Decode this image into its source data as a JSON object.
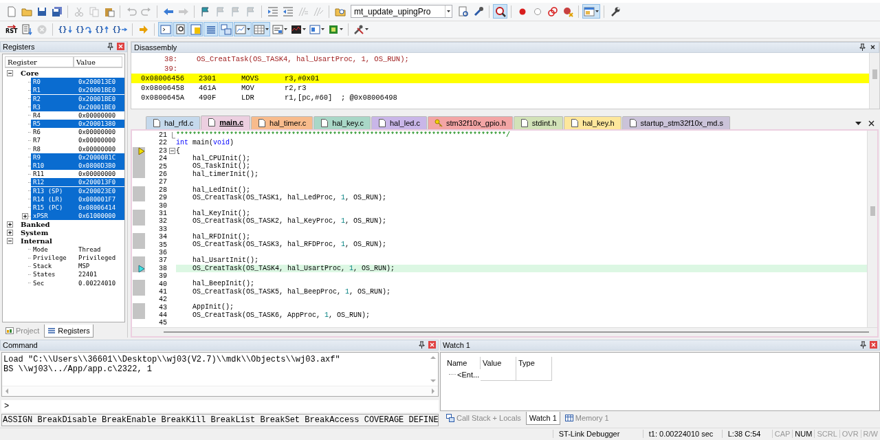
{
  "toolbar_1": [
    {
      "kind": "button",
      "on": false,
      "disabled": false,
      "dropdown": false
    },
    {
      "kind": "button",
      "on": false,
      "disabled": false,
      "dropdown": false
    },
    {
      "kind": "button",
      "on": false,
      "disabled": false,
      "dropdown": false
    },
    {
      "kind": "button",
      "on": false,
      "disabled": false,
      "dropdown": false
    },
    {
      "kind": "separator"
    },
    {
      "kind": "button",
      "on": false,
      "disabled": true,
      "dropdown": false
    },
    {
      "kind": "button",
      "on": false,
      "disabled": true,
      "dropdown": false
    },
    {
      "kind": "button",
      "on": false,
      "disabled": false,
      "dropdown": false
    },
    {
      "kind": "separator"
    },
    {
      "kind": "button",
      "on": false,
      "disabled": true,
      "dropdown": false
    },
    {
      "kind": "button",
      "on": false,
      "disabled": true,
      "dropdown": false
    },
    {
      "kind": "separator"
    },
    {
      "kind": "button",
      "on": false,
      "disabled": false,
      "dropdown": false
    },
    {
      "kind": "button",
      "on": false,
      "disabled": true,
      "dropdown": false
    },
    {
      "kind": "separator"
    },
    {
      "kind": "button",
      "on": false,
      "disabled": false,
      "dropdown": false
    },
    {
      "kind": "button",
      "on": false,
      "disabled": true,
      "dropdown": false
    },
    {
      "kind": "button",
      "on": false,
      "disabled": true,
      "dropdown": false
    },
    {
      "kind": "button",
      "on": false,
      "disabled": true,
      "dropdown": false
    },
    {
      "kind": "separator"
    },
    {
      "kind": "button",
      "on": false,
      "disabled": false,
      "dropdown": false
    },
    {
      "kind": "button",
      "on": false,
      "disabled": false,
      "dropdown": false
    },
    {
      "kind": "button",
      "on": false,
      "disabled": true,
      "dropdown": false
    },
    {
      "kind": "button",
      "on": false,
      "disabled": true,
      "dropdown": false
    },
    {
      "kind": "separator"
    },
    {
      "kind": "button",
      "on": false,
      "disabled": false,
      "dropdown": false
    },
    {
      "kind": "combo",
      "value": "mt_update_upingPro"
    },
    {
      "kind": "button",
      "on": false,
      "disabled": false,
      "dropdown": false
    },
    {
      "kind": "button",
      "on": false,
      "disabled": false,
      "dropdown": false
    },
    {
      "kind": "separator"
    },
    {
      "kind": "button",
      "on": true,
      "disabled": false,
      "dropdown": false
    },
    {
      "kind": "separator"
    },
    {
      "kind": "button",
      "on": false,
      "disabled": false,
      "dropdown": false
    },
    {
      "kind": "button",
      "on": false,
      "disabled": false,
      "dropdown": false
    },
    {
      "kind": "button",
      "on": false,
      "disabled": false,
      "dropdown": false
    },
    {
      "kind": "button",
      "on": false,
      "disabled": false,
      "dropdown": false
    },
    {
      "kind": "separator"
    },
    {
      "kind": "button",
      "on": true,
      "disabled": false,
      "dropdown": true
    },
    {
      "kind": "separator"
    },
    {
      "kind": "button",
      "on": false,
      "disabled": false,
      "dropdown": false
    }
  ],
  "toolbar_2": [
    {
      "kind": "button",
      "label": "RST",
      "on": false,
      "disabled": false,
      "dropdown": false
    },
    {
      "kind": "button",
      "on": false,
      "disabled": false,
      "dropdown": false
    },
    {
      "kind": "button",
      "on": false,
      "disabled": true,
      "dropdown": false
    },
    {
      "kind": "separator"
    },
    {
      "kind": "button",
      "label": "{}",
      "on": false,
      "disabled": false,
      "dropdown": false
    },
    {
      "kind": "button",
      "label": "{}",
      "on": false,
      "disabled": false,
      "dropdown": false
    },
    {
      "kind": "button",
      "label": "{}",
      "on": false,
      "disabled": false,
      "dropdown": false
    },
    {
      "kind": "button",
      "label": "{}",
      "on": false,
      "disabled": false,
      "dropdown": false
    },
    {
      "kind": "separator"
    },
    {
      "kind": "button",
      "on": false,
      "disabled": false,
      "dropdown": false
    },
    {
      "kind": "separator"
    },
    {
      "kind": "button",
      "on": true,
      "disabled": false,
      "dropdown": false
    },
    {
      "kind": "button",
      "on": true,
      "disabled": false,
      "dropdown": false
    },
    {
      "kind": "button",
      "on": true,
      "disabled": false,
      "dropdown": false
    },
    {
      "kind": "button",
      "on": true,
      "disabled": false,
      "dropdown": false
    },
    {
      "kind": "button",
      "on": true,
      "disabled": false,
      "dropdown": false
    },
    {
      "kind": "button",
      "on": true,
      "disabled": false,
      "dropdown": true
    },
    {
      "kind": "button",
      "on": true,
      "disabled": false,
      "dropdown": true
    },
    {
      "kind": "button",
      "on": false,
      "disabled": false,
      "dropdown": true
    },
    {
      "kind": "button",
      "on": false,
      "disabled": false,
      "dropdown": true
    },
    {
      "kind": "button",
      "on": false,
      "disabled": false,
      "dropdown": true
    },
    {
      "kind": "button",
      "on": false,
      "disabled": false,
      "dropdown": true
    },
    {
      "kind": "separator"
    },
    {
      "kind": "button",
      "on": false,
      "disabled": false,
      "dropdown": true
    }
  ],
  "registers": {
    "header": {
      "title": "Registers",
      "active": true
    },
    "columns": [
      "Register",
      "Value"
    ],
    "tree": [
      {
        "label": "Core",
        "expanded": true,
        "children": [
          {
            "label": "R0",
            "value": "0x200013E0",
            "changed": true
          },
          {
            "label": "R1",
            "value": "0x20001BE0",
            "changed": true
          },
          {
            "label": "R2",
            "value": "0x20001BE0",
            "changed": true
          },
          {
            "label": "R3",
            "value": "0x20001BE0",
            "changed": true
          },
          {
            "label": "R4",
            "value": "0x00000000",
            "changed": false
          },
          {
            "label": "R5",
            "value": "0x20001380",
            "changed": true
          },
          {
            "label": "R6",
            "value": "0x00000000",
            "changed": false
          },
          {
            "label": "R7",
            "value": "0x00000000",
            "changed": false
          },
          {
            "label": "R8",
            "value": "0x00000000",
            "changed": false
          },
          {
            "label": "R9",
            "value": "0x2000081C",
            "changed": true
          },
          {
            "label": "R10",
            "value": "0x0800D3B0",
            "changed": true
          },
          {
            "label": "R11",
            "value": "0x00000000",
            "changed": false
          },
          {
            "label": "R12",
            "value": "0x200013F0",
            "changed": true
          },
          {
            "label": "R13 (SP)",
            "value": "0x200023E0",
            "changed": true
          },
          {
            "label": "R14 (LR)",
            "value": "0x080001F7",
            "changed": true
          },
          {
            "label": "R15 (PC)",
            "value": "0x08006414",
            "changed": true
          },
          {
            "label": "xPSR",
            "value": "0x61000000",
            "changed": true,
            "expanded": false
          }
        ]
      },
      {
        "label": "Banked",
        "expanded": false
      },
      {
        "label": "System",
        "expanded": false
      },
      {
        "label": "Internal",
        "expanded": true,
        "children": [
          {
            "label": "Mode",
            "value": "Thread",
            "changed": false
          },
          {
            "label": "Privilege",
            "value": "Privileged",
            "changed": false
          },
          {
            "label": "Stack",
            "value": "MSP",
            "changed": false
          },
          {
            "label": "States",
            "value": "22401",
            "changed": false
          },
          {
            "label": "Sec",
            "value": "0.00224010",
            "changed": false
          }
        ]
      }
    ],
    "tabs": [
      {
        "label": "Project",
        "selected": false
      },
      {
        "label": "Registers",
        "selected": true
      }
    ]
  },
  "disassembly": {
    "header": {
      "title": "Disassembly",
      "active": false
    },
    "lines": [
      {
        "kind": "source",
        "line": "38:",
        "text": "OS_CreatTask(OS_TASK4, hal_UsartProc, 1, OS_RUN);"
      },
      {
        "kind": "source",
        "line": "39:"
      },
      {
        "kind": "asm",
        "address": "0x08006456",
        "opcode": "2301",
        "mnemonic": "MOVS",
        "operands": "r3,#0x01",
        "current": true
      },
      {
        "kind": "asm",
        "address": "0x08006458",
        "opcode": "461A",
        "mnemonic": "MOV",
        "operands": "r2,r3",
        "current": false
      },
      {
        "kind": "asm",
        "address": "0x0800645A",
        "opcode": "490F",
        "mnemonic": "LDR",
        "operands": "r1,[pc,#60]  ; @0x08006498",
        "current": false
      }
    ]
  },
  "editor": {
    "tabs": [
      {
        "label": "hal_rfd.c",
        "color": "#c5d9ec",
        "selected": false,
        "readonly": false
      },
      {
        "label": "main.c",
        "color": "#eccfe0",
        "selected": true,
        "readonly": false
      },
      {
        "label": "hal_timer.c",
        "color": "#f8bb8c",
        "selected": false,
        "readonly": false
      },
      {
        "label": "hal_key.c",
        "color": "#a9d7c7",
        "selected": false,
        "readonly": false
      },
      {
        "label": "hal_led.c",
        "color": "#c9b6e8",
        "selected": false,
        "readonly": false
      },
      {
        "label": "stm32f10x_gpio.h",
        "color": "#f3a5a5",
        "selected": false,
        "readonly": true
      },
      {
        "label": "stdint.h",
        "color": "#d2e2b8",
        "selected": false,
        "readonly": false
      },
      {
        "label": "hal_key.h",
        "color": "#fde79c",
        "selected": false,
        "readonly": false
      },
      {
        "label": "startup_stm32f10x_md.s",
        "color": "#cbc3d9",
        "selected": false,
        "readonly": false
      }
    ],
    "lines": [
      {
        "number": "21",
        "fold_end": true,
        "fold_start": false,
        "current": false,
        "caller": false,
        "executable": false,
        "highlighted": false,
        "segments": [
          {
            "kind": "comment",
            "text": "********************************************************************************/"
          }
        ]
      },
      {
        "number": "22",
        "fold_end": false,
        "fold_start": false,
        "current": false,
        "caller": false,
        "executable": false,
        "highlighted": false,
        "segments": [
          {
            "kind": "keyword",
            "text": "int"
          },
          {
            "kind": "plain",
            "text": " main("
          },
          {
            "kind": "keyword",
            "text": "void"
          },
          {
            "kind": "plain",
            "text": ")"
          }
        ]
      },
      {
        "number": "23",
        "fold_end": false,
        "fold_start": true,
        "current": true,
        "caller": false,
        "executable": true,
        "highlighted": false,
        "segments": [
          {
            "kind": "plain",
            "text": "{"
          }
        ]
      },
      {
        "number": "24",
        "executable": true,
        "highlighted": false,
        "segments": [
          {
            "kind": "plain",
            "text": "    hal_CPUInit();"
          }
        ]
      },
      {
        "number": "25",
        "executable": true,
        "highlighted": false,
        "segments": [
          {
            "kind": "plain",
            "text": "    OS_TaskInit();"
          }
        ]
      },
      {
        "number": "26",
        "executable": true,
        "highlighted": false,
        "segments": [
          {
            "kind": "plain",
            "text": "    hal_timerInit();"
          }
        ]
      },
      {
        "number": "27",
        "executable": false,
        "highlighted": false
      },
      {
        "number": "28",
        "executable": true,
        "highlighted": false,
        "segments": [
          {
            "kind": "plain",
            "text": "    hal_LedInit();"
          }
        ]
      },
      {
        "number": "29",
        "executable": true,
        "highlighted": false,
        "segments": [
          {
            "kind": "plain",
            "text": "    OS_CreatTask(OS_TASK1, hal_LedProc, "
          },
          {
            "kind": "number",
            "text": "1"
          },
          {
            "kind": "plain",
            "text": ", OS_RUN);"
          }
        ]
      },
      {
        "number": "30",
        "executable": false,
        "highlighted": false
      },
      {
        "number": "31",
        "executable": true,
        "highlighted": false,
        "segments": [
          {
            "kind": "plain",
            "text": "    hal_KeyInit();"
          }
        ]
      },
      {
        "number": "32",
        "executable": true,
        "highlighted": false,
        "segments": [
          {
            "kind": "plain",
            "text": "    OS_CreatTask(OS_TASK2, hal_KeyProc, "
          },
          {
            "kind": "number",
            "text": "1"
          },
          {
            "kind": "plain",
            "text": ", OS_RUN);"
          }
        ]
      },
      {
        "number": "33",
        "executable": false,
        "highlighted": false
      },
      {
        "number": "34",
        "executable": true,
        "highlighted": false,
        "segments": [
          {
            "kind": "plain",
            "text": "    hal_RFDInit();"
          }
        ]
      },
      {
        "number": "35",
        "executable": true,
        "highlighted": false,
        "segments": [
          {
            "kind": "plain",
            "text": "    OS_CreatTask(OS_TASK3, hal_RFDProc, "
          },
          {
            "kind": "number",
            "text": "1"
          },
          {
            "kind": "plain",
            "text": ", OS_RUN);"
          }
        ]
      },
      {
        "number": "36",
        "executable": false,
        "highlighted": false
      },
      {
        "number": "37",
        "executable": true,
        "highlighted": false,
        "segments": [
          {
            "kind": "plain",
            "text": "    hal_UsartInit();"
          }
        ]
      },
      {
        "number": "38",
        "fold_end": false,
        "fold_start": false,
        "current": false,
        "caller": true,
        "executable": true,
        "highlighted": true,
        "segments": [
          {
            "kind": "plain",
            "text": "    OS_CreatTask(OS_TASK4, hal_UsartProc, "
          },
          {
            "kind": "number",
            "text": "1"
          },
          {
            "kind": "plain",
            "text": ", OS_RUN);"
          }
        ]
      },
      {
        "number": "39",
        "executable": false,
        "highlighted": false
      },
      {
        "number": "40",
        "executable": true,
        "highlighted": false,
        "segments": [
          {
            "kind": "plain",
            "text": "    hal_BeepInit();"
          }
        ]
      },
      {
        "number": "41",
        "executable": true,
        "highlighted": false,
        "segments": [
          {
            "kind": "plain",
            "text": "    OS_CreatTask(OS_TASK5, hal_BeepProc, "
          },
          {
            "kind": "number",
            "text": "1"
          },
          {
            "kind": "plain",
            "text": ", OS_RUN);"
          }
        ]
      },
      {
        "number": "42",
        "executable": false,
        "highlighted": false
      },
      {
        "number": "43",
        "executable": true,
        "highlighted": false,
        "segments": [
          {
            "kind": "plain",
            "text": "    AppInit();"
          }
        ]
      },
      {
        "number": "44",
        "executable": true,
        "highlighted": false,
        "segments": [
          {
            "kind": "plain",
            "text": "    OS_CreatTask(OS_TASK6, AppProc, "
          },
          {
            "kind": "number",
            "text": "1"
          },
          {
            "kind": "plain",
            "text": ", OS_RUN);"
          }
        ]
      },
      {
        "number": "45",
        "executable": false,
        "highlighted": false
      }
    ]
  },
  "command": {
    "header": {
      "title": "Command",
      "active": true
    },
    "output": [
      "Load \"C:\\\\Users\\\\36601\\\\Desktop\\\\wj03(V2.7)\\\\mdk\\\\Objects\\\\wj03.axf\"",
      "BS \\\\wj03\\../App/app.c\\2322, 1"
    ],
    "prompt": ">",
    "help": "ASSIGN BreakDisable BreakEnable BreakKill BreakList BreakSet BreakAccess COVERAGE DEFINE"
  },
  "watch": {
    "header": {
      "title": "Watch 1",
      "active": true
    },
    "columns": [
      "Name",
      "Value",
      "Type"
    ],
    "rows": [
      {
        "name": "<Ent..."
      }
    ],
    "tabs": [
      {
        "label": "Call Stack + Locals",
        "selected": false
      },
      {
        "label": "Watch 1",
        "selected": true
      },
      {
        "label": "Memory 1",
        "selected": false
      }
    ]
  },
  "status_bar": {
    "debugger": "ST-Link Debugger",
    "time": "t1: 0.00224010 sec",
    "position": "L:38 C:54",
    "indicators": [
      {
        "text": "CAP",
        "on": false
      },
      {
        "text": "NUM",
        "on": true
      },
      {
        "text": "SCRL",
        "on": false
      },
      {
        "text": "OVR",
        "on": false
      },
      {
        "text": "R/W",
        "on": false
      }
    ]
  }
}
